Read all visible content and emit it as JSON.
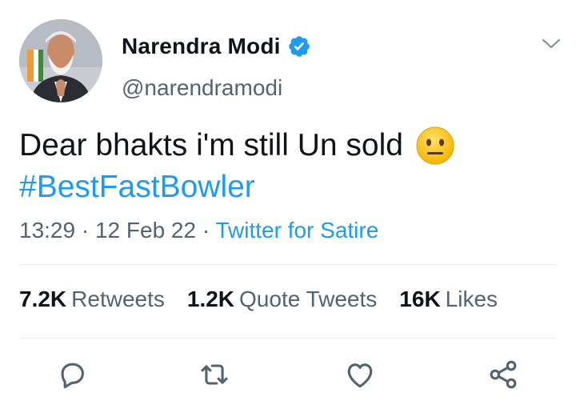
{
  "tweet": {
    "author_name": "Narendra Modi",
    "handle": "@narendramodi",
    "text": "Dear bhakts i'm still Un sold",
    "hashtag": "#BestFastBowler",
    "time": "13:29",
    "date": "12 Feb 22",
    "source": "Twitter for Satire",
    "separator": " · "
  },
  "stats": {
    "retweets_count": "7.2K",
    "retweets_label": "Retweets",
    "quotes_count": "1.2K",
    "quotes_label": "Quote Tweets",
    "likes_count": "16K",
    "likes_label": "Likes"
  },
  "icons": {
    "verified": "verified-badge-icon",
    "menu": "chevron-down-icon",
    "emoji": "neutral-face-emoji",
    "reply": "reply-icon",
    "retweet": "retweet-icon",
    "like": "heart-icon",
    "share": "share-icon"
  },
  "colors": {
    "accent": "#1d9bf0",
    "text_primary": "#0f1419",
    "text_secondary": "#536471",
    "divider": "#e6ecf0"
  }
}
